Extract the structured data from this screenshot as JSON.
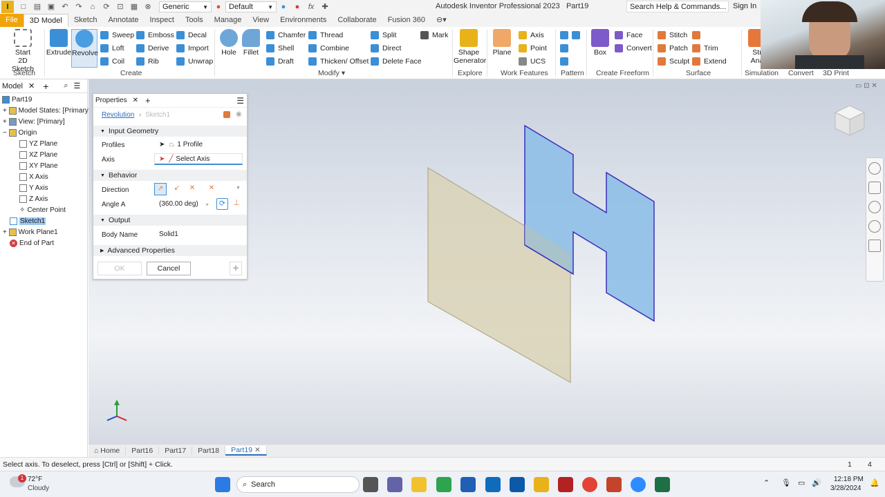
{
  "app": {
    "title": "Autodesk Inventor Professional 2023",
    "doc": "Part19"
  },
  "toolbar": {
    "material": "Generic",
    "appearance": "Default"
  },
  "help_search": "Search Help & Commands...",
  "sign_in": "Sign In",
  "tabs": [
    "File",
    "3D Model",
    "Sketch",
    "Annotate",
    "Inspect",
    "Tools",
    "Manage",
    "View",
    "Environments",
    "Collaborate",
    "Fusion 360"
  ],
  "ribbon": {
    "sketch": {
      "btn": "Start\n2D Sketch",
      "start": "Start",
      "sketch2d": "2D Sketch",
      "panel": "Sketch"
    },
    "create": {
      "extrude": "Extrude",
      "revolve": "Revolve",
      "sweep": "Sweep",
      "emboss": "Emboss",
      "decal": "Decal",
      "loft": "Loft",
      "derive": "Derive",
      "import": "Import",
      "coil": "Coil",
      "rib": "Rib",
      "unwrap": "Unwrap",
      "panel": "Create"
    },
    "modify": {
      "hole": "Hole",
      "fillet": "Fillet",
      "chamfer": "Chamfer",
      "shell": "Shell",
      "draft": "Draft",
      "thread": "Thread",
      "combine": "Combine",
      "thicken": "Thicken/ Offset",
      "split": "Split",
      "direct": "Direct",
      "delete_face": "Delete Face",
      "mark": "Mark",
      "panel": "Modify"
    },
    "explore": {
      "shape_gen_1": "Shape",
      "shape_gen_2": "Generator",
      "panel": "Explore"
    },
    "work": {
      "plane": "Plane",
      "axis": "Axis",
      "point": "Point",
      "ucs": "UCS",
      "panel": "Work Features"
    },
    "pattern": {
      "panel": "Pattern"
    },
    "freeform": {
      "box": "Box",
      "face": "Face",
      "convert": "Convert",
      "panel": "Create Freeform"
    },
    "surface": {
      "stitch": "Stitch",
      "patch": "Patch",
      "sculpt": "Sculpt",
      "trim": "Trim",
      "extend": "Extend",
      "panel": "Surface"
    },
    "simulation": {
      "stress_1": "Str",
      "stress_2": "Ana",
      "panel": "Simulation"
    },
    "convert_panel": "Convert",
    "print_panel": "3D Print"
  },
  "browser": {
    "title": "Model",
    "nodes": [
      {
        "label": "Part19",
        "color": "#3b8fd6"
      },
      {
        "label": "Model States: [Primary]",
        "color": "#e6c04a"
      },
      {
        "label": "View: [Primary]",
        "color": "#7a9bbd"
      },
      {
        "label": "Origin",
        "color": "#e6c04a"
      },
      {
        "label": "YZ Plane",
        "color": "#999"
      },
      {
        "label": "XZ Plane",
        "color": "#999"
      },
      {
        "label": "XY Plane",
        "color": "#999"
      },
      {
        "label": "X Axis",
        "color": "#999"
      },
      {
        "label": "Y Axis",
        "color": "#999"
      },
      {
        "label": "Z Axis",
        "color": "#999"
      },
      {
        "label": "Center Point",
        "color": "#999"
      },
      {
        "label": "Sketch1",
        "color": "#3b8fd6"
      },
      {
        "label": "Work Plane1",
        "color": "#e6c04a"
      },
      {
        "label": "End of Part",
        "color": "#d23b3b"
      }
    ]
  },
  "props": {
    "title": "Properties",
    "feature": "Revolution",
    "sketch": "Sketch1",
    "input_geometry": "Input Geometry",
    "profiles_label": "Profiles",
    "profiles_value": "1 Profile",
    "axis_label": "Axis",
    "axis_value": "Select Axis",
    "behavior": "Behavior",
    "direction_label": "Direction",
    "angle_label": "Angle A",
    "angle_value": "(360.00 deg)",
    "output": "Output",
    "body_name_label": "Body Name",
    "body_name_value": "Solid1",
    "advanced": "Advanced Properties",
    "ok": "OK",
    "cancel": "Cancel"
  },
  "doc_tabs": [
    "Home",
    "Part16",
    "Part17",
    "Part18",
    "Part19"
  ],
  "status": {
    "message": "Select axis. To deselect, press [Ctrl] or [Shift] + Click.",
    "n1": "1",
    "n2": "4"
  },
  "taskbar": {
    "temp": "72°F",
    "weather": "Cloudy",
    "search": "Search",
    "time": "12:18 PM",
    "date": "3/28/2024",
    "badge": "1"
  },
  "colors": {
    "accent": "#f0a30a",
    "sketch_fill": "#8fbfe8",
    "sketch_edge": "#3b2fb8",
    "plane_fill": "#d9d2b6"
  }
}
